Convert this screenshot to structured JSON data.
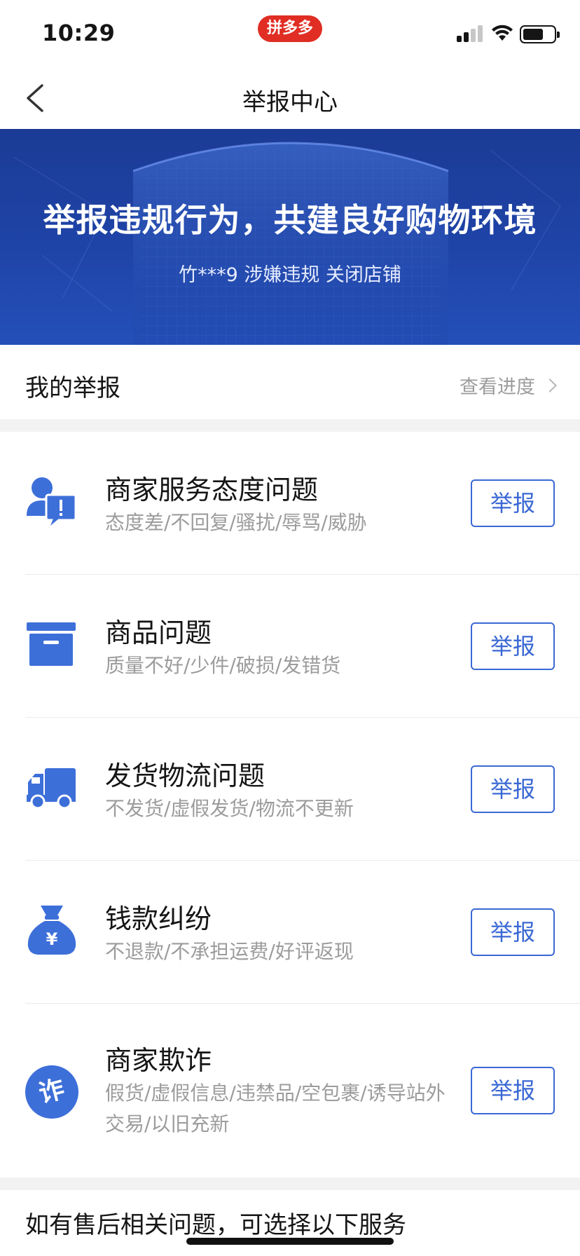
{
  "status_bar": {
    "time": "10:29",
    "app_badge": "拼多多"
  },
  "nav": {
    "title": "举报中心"
  },
  "banner": {
    "title": "举报违规行为，共建良好购物环境",
    "subtitle": "竹***9 涉嫌违规 关闭店铺"
  },
  "my_reports": {
    "label": "我的举报",
    "link": "查看进度"
  },
  "categories": [
    {
      "title": "商家服务态度问题",
      "desc": "态度差/不回复/骚扰/辱骂/威胁",
      "button": "举报",
      "icon": "merchant-service-icon"
    },
    {
      "title": "商品问题",
      "desc": "质量不好/少件/破损/发错货",
      "button": "举报",
      "icon": "product-box-icon"
    },
    {
      "title": "发货物流问题",
      "desc": "不发货/虚假发货/物流不更新",
      "button": "举报",
      "icon": "delivery-truck-icon"
    },
    {
      "title": "钱款纠纷",
      "desc": "不退款/不承担运费/好评返现",
      "button": "举报",
      "icon": "money-bag-icon"
    },
    {
      "title": "商家欺诈",
      "desc": "假货/虚假信息/违禁品/空包裹/诱导站外交易/以旧充新",
      "button": "举报",
      "icon": "fraud-icon",
      "icon_text": "诈"
    }
  ],
  "after_sales": {
    "text": "如有售后相关问题，可选择以下服务"
  },
  "colors": {
    "accent": "#3a68d4",
    "icon_blue": "#3d6fd9",
    "brand_red": "#e02e24",
    "banner_blue": "#1f44a8"
  }
}
